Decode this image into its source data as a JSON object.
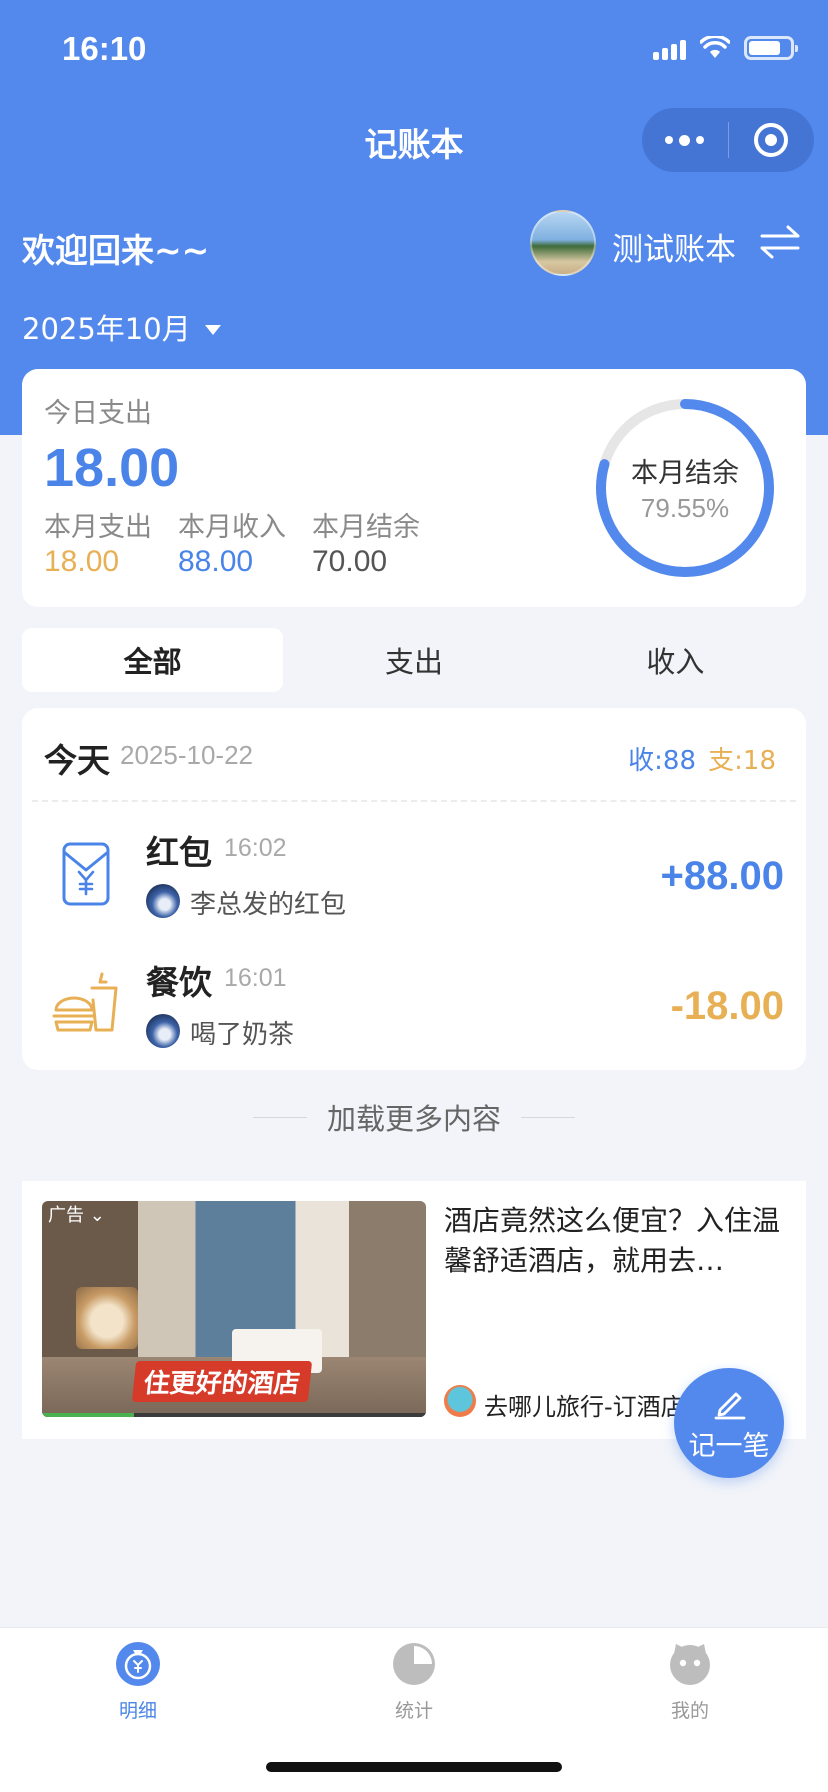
{
  "status_bar": {
    "time": "16:10"
  },
  "nav": {
    "title": "记账本"
  },
  "header": {
    "welcome": "欢迎回来~~",
    "book_name": "测试账本",
    "month": "2025年10月"
  },
  "summary": {
    "today_label": "今日支出",
    "today_amount": "18.00",
    "month_expense_label": "本月支出",
    "month_expense": "18.00",
    "month_income_label": "本月收入",
    "month_income": "88.00",
    "month_balance_label": "本月结余",
    "month_balance": "70.00",
    "ring_label": "本月结余",
    "ring_percent": "79.55%",
    "ring_ratio": 0.7955
  },
  "tabs": [
    {
      "label": "全部",
      "active": true
    },
    {
      "label": "支出",
      "active": false
    },
    {
      "label": "收入",
      "active": false
    }
  ],
  "day_group": {
    "title": "今天",
    "date": "2025-10-22",
    "income": "收:88",
    "expense": "支:18"
  },
  "records": [
    {
      "icon": "red-envelope-icon",
      "category": "红包",
      "time": "16:02",
      "note": "李总发的红包",
      "amount": "+88.00",
      "type": "income"
    },
    {
      "icon": "food-drink-icon",
      "category": "餐饮",
      "time": "16:01",
      "note": "喝了奶茶",
      "amount": "-18.00",
      "type": "expense"
    }
  ],
  "load_more": "加载更多内容",
  "ad": {
    "tag": "广告",
    "caption": "住更好的酒店",
    "title": "酒店竟然这么便宜？入住温馨舒适酒店，就用去…",
    "brand": "去哪儿旅行-订酒店",
    "video_progress": 0.24
  },
  "fab": {
    "label": "记一笔"
  },
  "tabbar": [
    {
      "label": "明细",
      "icon": "money-bag-icon",
      "active": true
    },
    {
      "label": "统计",
      "icon": "pie-chart-icon",
      "active": false
    },
    {
      "label": "我的",
      "icon": "face-icon",
      "active": false
    }
  ],
  "colors": {
    "primary": "#5389ec",
    "expense": "#e8b055",
    "income": "#4a84e8",
    "background": "#f2f4f9"
  }
}
